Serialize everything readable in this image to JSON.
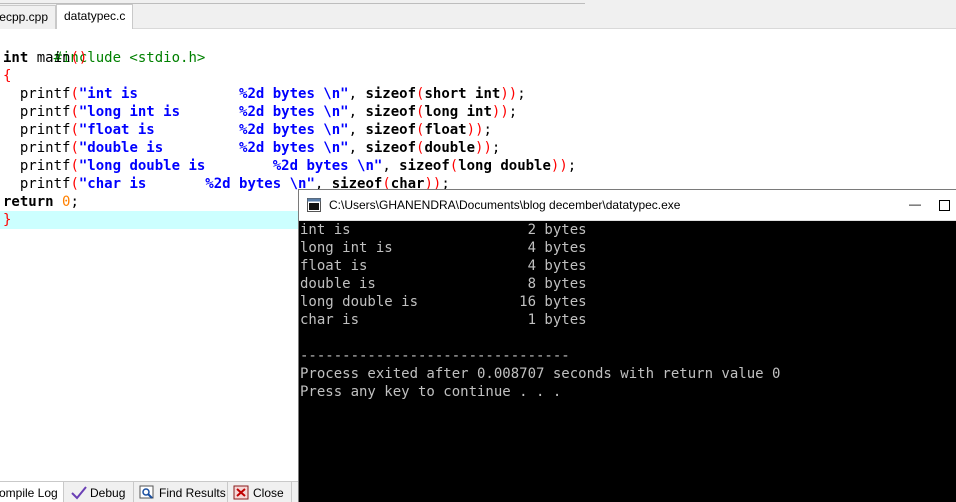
{
  "tabs": [
    {
      "label": "ecpp.cpp"
    },
    {
      "label": "datatypec.c"
    }
  ],
  "code": {
    "line1": {
      "text": "#include <stdio.h>"
    },
    "line2": {
      "kw": "int",
      "name": " main",
      "paren": "()"
    },
    "line3": {
      "brace": "{"
    },
    "printf_lines": [
      {
        "indent": "  ",
        "fn": "printf",
        "open": "(",
        "str": "\"int is            %2d bytes \\n\"",
        "comma": ", ",
        "sizeof": "sizeof",
        "p2o": "(",
        "type": "short int",
        "p2c": ")",
        "close": ")",
        "semi": ";"
      },
      {
        "indent": "  ",
        "fn": "printf",
        "open": "(",
        "str": "\"long int is       %2d bytes \\n\"",
        "comma": ", ",
        "sizeof": "sizeof",
        "p2o": "(",
        "type": "long int",
        "p2c": ")",
        "close": ")",
        "semi": ";"
      },
      {
        "indent": "  ",
        "fn": "printf",
        "open": "(",
        "str": "\"float is          %2d bytes \\n\"",
        "comma": ", ",
        "sizeof": "sizeof",
        "p2o": "(",
        "type": "float",
        "p2c": ")",
        "close": ")",
        "semi": ";"
      },
      {
        "indent": "  ",
        "fn": "printf",
        "open": "(",
        "str": "\"double is         %2d bytes \\n\"",
        "comma": ", ",
        "sizeof": "sizeof",
        "p2o": "(",
        "type": "double",
        "p2c": ")",
        "close": ")",
        "semi": ";"
      },
      {
        "indent": "  ",
        "fn": "printf",
        "open": "(",
        "str": "\"long double is        %2d bytes \\n\"",
        "comma": ", ",
        "sizeof": "sizeof",
        "p2o": "(",
        "type": "long double",
        "p2c": ")",
        "close": ")",
        "semi": ";"
      },
      {
        "indent": "  ",
        "fn": "printf",
        "open": "(",
        "str": "\"char is       %2d bytes \\n\"",
        "comma": ", ",
        "sizeof": "sizeof",
        "p2o": "(",
        "type": "char",
        "p2c": ")",
        "close": ")",
        "semi": ";"
      }
    ],
    "return_line": {
      "kw": "return",
      "space": " ",
      "num": "0",
      "semi": ";"
    },
    "close_line": {
      "brace": "}"
    }
  },
  "bottom_tabs": {
    "compile_log": "ompile Log",
    "debug": "Debug",
    "find_results": "Find Results",
    "close": "Close"
  },
  "console": {
    "title": "C:\\Users\\GHANENDRA\\Documents\\blog december\\datatypec.exe",
    "min_symbol": "—",
    "output": [
      "int is                     2 bytes",
      "long int is                4 bytes",
      "float is                   4 bytes",
      "double is                  8 bytes",
      "long double is            16 bytes",
      "char is                    1 bytes",
      "",
      "--------------------------------",
      "Process exited after 0.008707 seconds with return value 0",
      "Press any key to continue . . ."
    ]
  },
  "colors": {
    "keyword": "#000000",
    "string": "#0000ff",
    "paren": "#ff0000",
    "preprocessor": "#008000",
    "number": "#ff8000",
    "current_line": "#ccffff",
    "console_bg": "#000000",
    "console_text": "#c0c0c0"
  }
}
